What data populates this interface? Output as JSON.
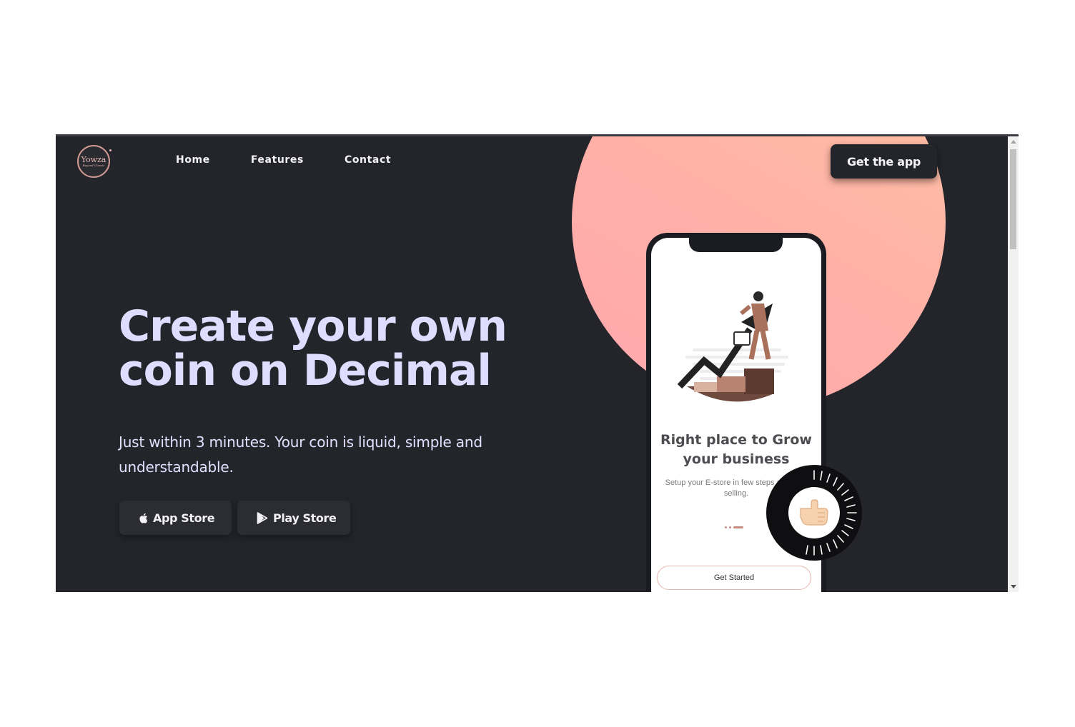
{
  "brand": {
    "logo_text": "Yowza",
    "logo_sub": "Beyond Classic"
  },
  "nav": {
    "items": [
      "Home",
      "Features",
      "Contact"
    ]
  },
  "header": {
    "cta_label": "Get the app"
  },
  "hero": {
    "title_line1": "Create your own",
    "title_line2": "coin on Decimal",
    "subtitle": "Just within 3 minutes. Your coin is liquid, simple and understandable.",
    "buttons": {
      "app_store": "App Store",
      "play_store": "Play Store"
    }
  },
  "phone": {
    "title": "Right place to Grow your business",
    "description": "Setup your E-store in few steps and start selling.",
    "cta_label": "Get Started"
  },
  "colors": {
    "background": "#23252b",
    "accent_circle": "#ffb2a6",
    "headline": "#e0dcff",
    "button": "#2b2d33"
  },
  "icons": [
    "logo",
    "apple-icon",
    "play-store-icon",
    "growth-illustration",
    "thumbs-up-icon",
    "dial-ring"
  ]
}
